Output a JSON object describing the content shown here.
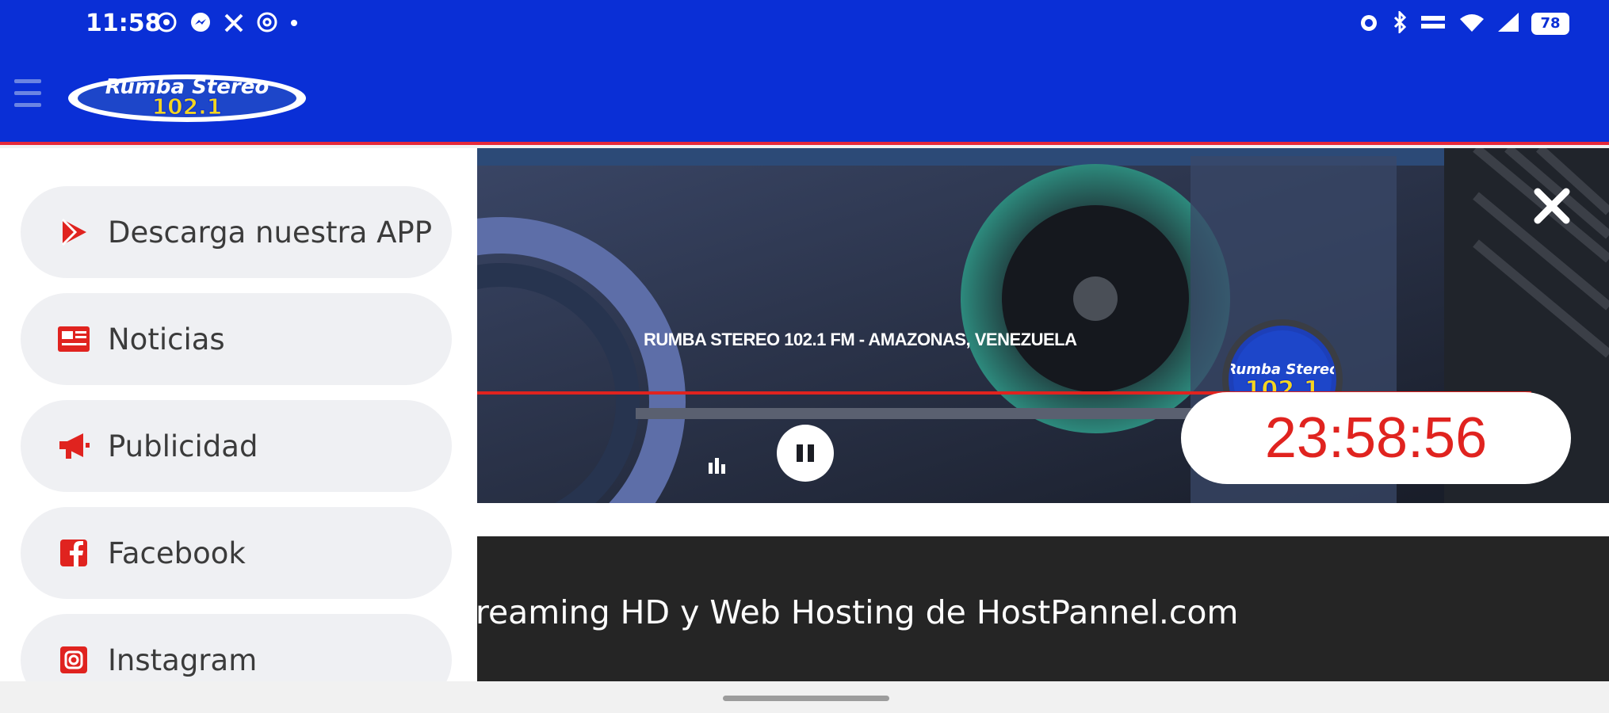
{
  "status_bar": {
    "time": "11:58",
    "app_icons": [
      "whatsapp-icon",
      "messenger-icon",
      "x-icon",
      "threads-icon",
      "dot-icon"
    ],
    "system_icons": [
      "alarm-icon",
      "bluetooth-icon",
      "data-speed-icon",
      "wifi-icon",
      "signal-icon"
    ],
    "battery": "78"
  },
  "header": {
    "logo_text": "Rumba Stereo",
    "logo_freq": "102.1"
  },
  "drawer": {
    "items": [
      {
        "label": "Descarga nuestra APP",
        "icon": "play-store-icon"
      },
      {
        "label": "Noticias",
        "icon": "newspaper-icon"
      },
      {
        "label": "Publicidad",
        "icon": "megaphone-icon"
      },
      {
        "label": "Facebook",
        "icon": "facebook-icon"
      },
      {
        "label": "Instagram",
        "icon": "instagram-icon"
      }
    ]
  },
  "player": {
    "station_caption": "RUMBA STEREO 102.1 FM - AMAZONAS, VENEZUELA",
    "disc_line1": "Rumba Stereo",
    "disc_line2": "102.1",
    "timer": "23:58:56",
    "state": "playing"
  },
  "banner": {
    "text": "reaming HD y Web Hosting de HostPannel.com"
  },
  "colors": {
    "header_blue": "#0a2fd6",
    "accent_red": "#e0231f",
    "drawer_item_bg": "#eff0f3"
  }
}
